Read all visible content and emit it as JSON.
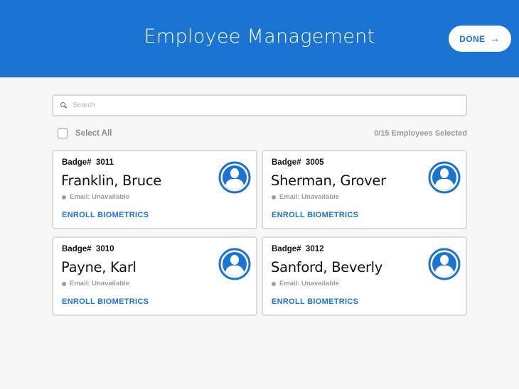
{
  "header": {
    "title": "Employee Management",
    "done_label": "DONE",
    "done_icon": "arrow-right-icon",
    "background": "#1b74d2"
  },
  "search": {
    "placeholder": "Search",
    "value": ""
  },
  "selection": {
    "select_all_label": "Select All",
    "count_text": "0/15 Employees Selected"
  },
  "employees": [
    {
      "badge": "Badge#  3011",
      "name": "Franklin, Bruce",
      "email": "Email: Unavailable",
      "action": "ENROLL BIOMETRICS"
    },
    {
      "badge": "Badge#  3005",
      "name": "Sherman, Grover",
      "email": "Email: Unavailable",
      "action": "ENROLL BIOMETRICS"
    },
    {
      "badge": "Badge#  3010",
      "name": "Payne, Karl",
      "email": "Email: Unavailable",
      "action": "ENROLL BIOMETRICS"
    },
    {
      "badge": "Badge#  3012",
      "name": "Sanford, Beverly",
      "email": "Email: Unavailable",
      "action": "ENROLL BIOMETRICS"
    }
  ],
  "colors": {
    "accent": "#1b74d2",
    "card_border": "#dcdcdc",
    "muted_text": "#9b9b9b"
  }
}
